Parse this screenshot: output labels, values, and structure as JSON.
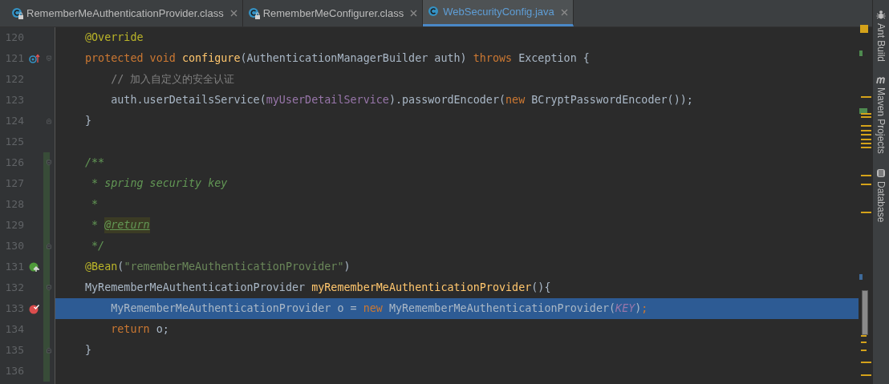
{
  "tabs": [
    {
      "label": "RememberMeAuthenticationProvider.class",
      "locked": true,
      "selected": false
    },
    {
      "label": "RememberMeConfigurer.class",
      "locked": true,
      "selected": false
    },
    {
      "label": "WebSecurityConfig.java",
      "locked": false,
      "selected": true
    }
  ],
  "lines": [
    {
      "number": "120",
      "selected": false,
      "changed": false,
      "tokens": [
        {
          "kind": "annotation",
          "text": "@Override"
        }
      ]
    },
    {
      "number": "121",
      "selected": false,
      "changed": false,
      "gutter_mark": {
        "kind": "override"
      },
      "fold": {
        "kind": "start"
      },
      "tokens": [
        {
          "kind": "keyword",
          "text": "protected void "
        },
        {
          "kind": "method",
          "text": "configure"
        },
        {
          "kind": "plain",
          "text": "(AuthenticationManagerBuilder auth) "
        },
        {
          "kind": "keyword",
          "text": "throws "
        },
        {
          "kind": "plain",
          "text": "Exception {"
        }
      ]
    },
    {
      "number": "122",
      "selected": false,
      "changed": false,
      "tokens": [
        {
          "kind": "comment",
          "text": "    // 加入自定义的安全认证"
        }
      ]
    },
    {
      "number": "123",
      "selected": false,
      "changed": false,
      "tokens": [
        {
          "kind": "plain",
          "text": "    auth.userDetailsService("
        },
        {
          "kind": "field",
          "text": "myUserDetailService"
        },
        {
          "kind": "plain",
          "text": ").passwordEncoder("
        },
        {
          "kind": "keyword",
          "text": "new "
        },
        {
          "kind": "plain",
          "text": "BCryptPasswordEncoder());"
        }
      ]
    },
    {
      "number": "124",
      "selected": false,
      "changed": false,
      "fold": {
        "kind": "end"
      },
      "tokens": [
        {
          "kind": "plain",
          "text": "}"
        }
      ]
    },
    {
      "number": "125",
      "selected": false,
      "changed": false
    },
    {
      "number": "126",
      "selected": false,
      "changed": true,
      "fold": {
        "kind": "start"
      },
      "tokens": [
        {
          "kind": "doc",
          "text": "/**"
        }
      ]
    },
    {
      "number": "127",
      "selected": false,
      "changed": true,
      "tokens": [
        {
          "kind": "doc",
          "text": " * spring security key"
        }
      ]
    },
    {
      "number": "128",
      "selected": false,
      "changed": true,
      "tokens": [
        {
          "kind": "doc",
          "text": " *"
        }
      ]
    },
    {
      "number": "129",
      "selected": false,
      "changed": true,
      "tokens": [
        {
          "kind": "doc",
          "text": " * "
        },
        {
          "kind": "doctag",
          "text": "@return"
        }
      ]
    },
    {
      "number": "130",
      "selected": false,
      "changed": true,
      "fold": {
        "kind": "end"
      },
      "tokens": [
        {
          "kind": "doc",
          "text": " */"
        }
      ]
    },
    {
      "number": "131",
      "selected": false,
      "changed": true,
      "gutter_mark": {
        "kind": "bean"
      },
      "tokens": [
        {
          "kind": "annotation",
          "text": "@Bean"
        },
        {
          "kind": "plain",
          "text": "("
        },
        {
          "kind": "string",
          "text": "\"rememberMeAuthenticationProvider\""
        },
        {
          "kind": "plain",
          "text": ")"
        }
      ]
    },
    {
      "number": "132",
      "selected": false,
      "changed": true,
      "fold": {
        "kind": "start"
      },
      "tokens": [
        {
          "kind": "plain",
          "text": "MyRememberMeAuthenticationProvider "
        },
        {
          "kind": "method",
          "text": "myRememberMeAuthenticationProvider"
        },
        {
          "kind": "plain",
          "text": "(){"
        }
      ]
    },
    {
      "number": "133",
      "selected": true,
      "changed": true,
      "gutter_mark": {
        "kind": "breakpoint"
      },
      "tokens": [
        {
          "kind": "plain",
          "text": "    MyRememberMeAuthenticationProvider o = "
        },
        {
          "kind": "keyword",
          "text": "new "
        },
        {
          "kind": "plain",
          "text": "MyRememberMeAuthenticationProvider("
        },
        {
          "kind": "constant",
          "text": "KEY"
        },
        {
          "kind": "plain",
          "text": ")"
        },
        {
          "kind": "keyword",
          "text": ";"
        }
      ]
    },
    {
      "number": "134",
      "selected": false,
      "changed": true,
      "tokens": [
        {
          "kind": "keyword",
          "text": "    return "
        },
        {
          "kind": "plain",
          "text": "o;"
        }
      ]
    },
    {
      "number": "135",
      "selected": false,
      "changed": true,
      "fold": {
        "kind": "end"
      },
      "tokens": [
        {
          "kind": "plain",
          "text": "}"
        }
      ]
    },
    {
      "number": "136",
      "selected": false,
      "changed": true
    }
  ],
  "tool_windows": [
    {
      "label": "Ant Build"
    },
    {
      "label": "Maven Projects"
    },
    {
      "label": "Database"
    }
  ]
}
